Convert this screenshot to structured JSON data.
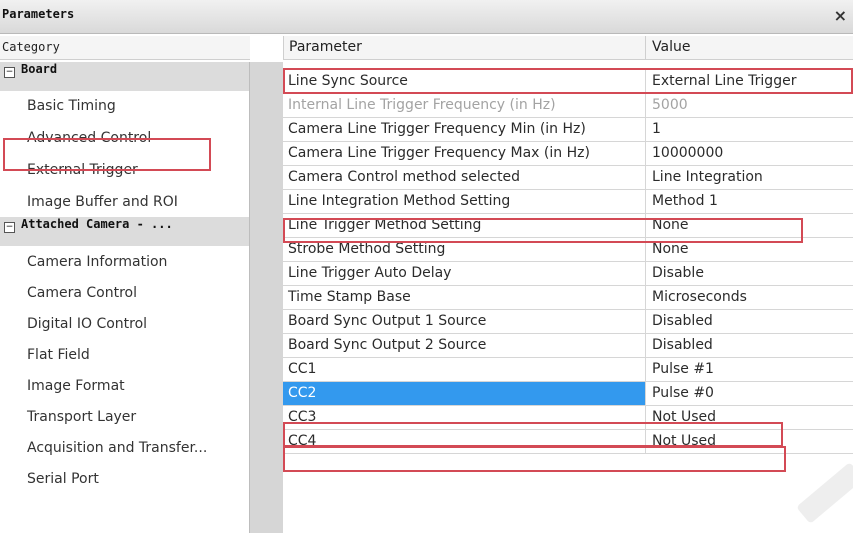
{
  "window": {
    "title": "Parameters",
    "close_glyph": "×"
  },
  "columns": {
    "category": "Category",
    "parameter": "Parameter",
    "value": "Value"
  },
  "sidebar": {
    "groups": [
      {
        "toggle": "−",
        "label": "Board"
      },
      {
        "toggle": "−",
        "label": "Attached Camera - ..."
      }
    ],
    "items": [
      "Basic Timing",
      "Advanced Control",
      "External Trigger",
      "Image Buffer and ROI",
      "Camera Information",
      "Camera Control",
      "Digital IO Control",
      "Flat Field",
      "Image Format",
      "Transport Layer",
      "Acquisition and Transfer...",
      "Serial Port"
    ]
  },
  "rows": [
    {
      "parameter": "Line Sync Source",
      "value": "External Line Trigger"
    },
    {
      "parameter": "Internal Line Trigger Frequency (in Hz)",
      "value": "5000"
    },
    {
      "parameter": "Camera Line Trigger Frequency Min (in Hz)",
      "value": "1"
    },
    {
      "parameter": "Camera Line Trigger Frequency Max (in Hz)",
      "value": "10000000"
    },
    {
      "parameter": "Camera Control method selected",
      "value": "Line Integration"
    },
    {
      "parameter": "Line Integration Method Setting",
      "value": "Method 1"
    },
    {
      "parameter": "Line Trigger Method Setting",
      "value": "None"
    },
    {
      "parameter": "Strobe Method Setting",
      "value": "None"
    },
    {
      "parameter": "Line Trigger Auto Delay",
      "value": "Disable"
    },
    {
      "parameter": "Time Stamp Base",
      "value": "Microseconds"
    },
    {
      "parameter": "Board Sync Output 1 Source",
      "value": "Disabled"
    },
    {
      "parameter": "Board Sync Output 2 Source",
      "value": "Disabled"
    },
    {
      "parameter": "CC1",
      "value": "Pulse #1"
    },
    {
      "parameter": "CC2",
      "value": "Pulse #0"
    },
    {
      "parameter": "CC3",
      "value": "Not Used"
    },
    {
      "parameter": "CC4",
      "value": "Not Used"
    }
  ],
  "colors": {
    "selection": "#3399ee",
    "highlight_border": "#d34a55",
    "group_header": "#dcdcdc"
  }
}
